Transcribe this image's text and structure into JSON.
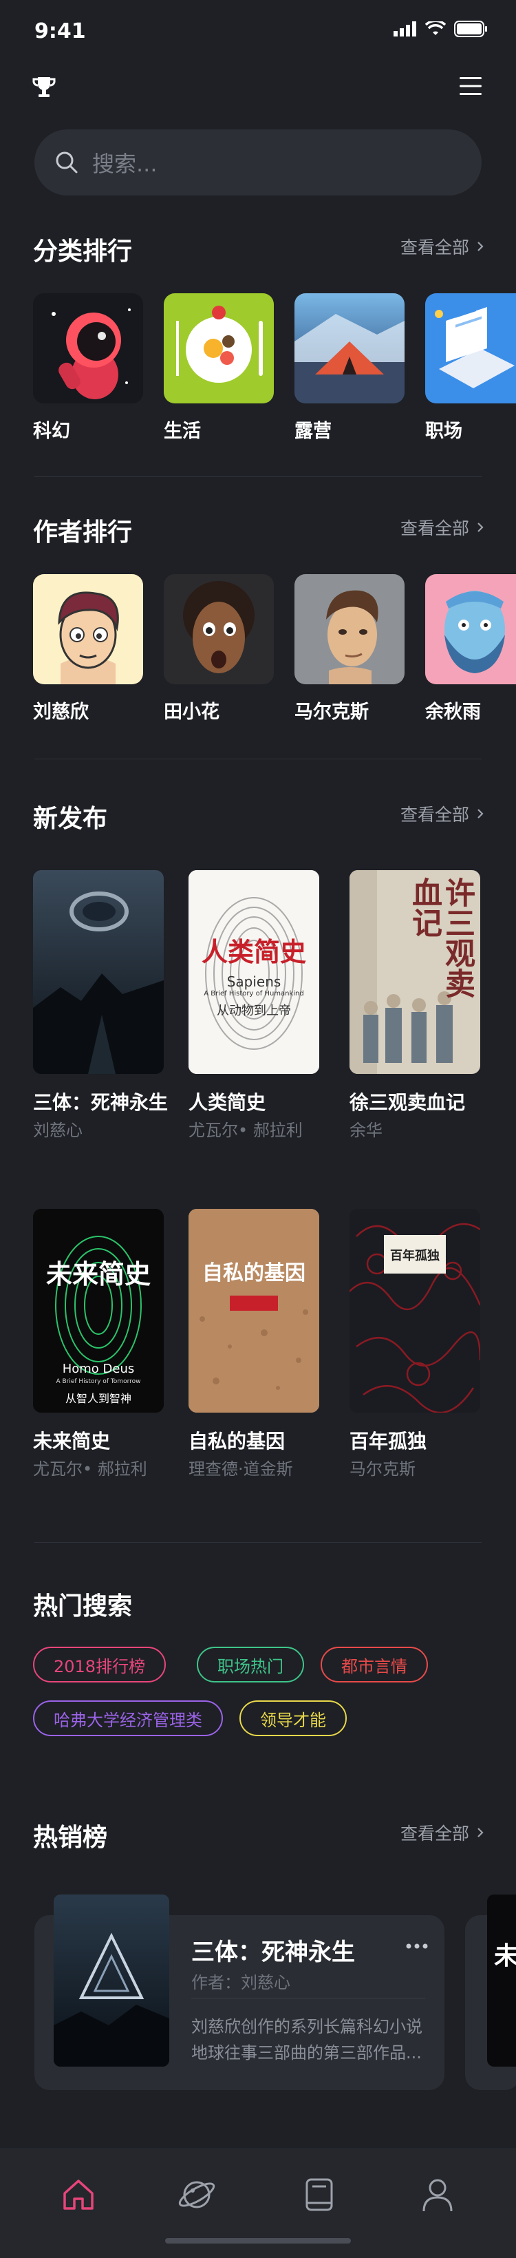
{
  "status": {
    "time": "9:41"
  },
  "search": {
    "placeholder": "搜索..."
  },
  "categories": {
    "title": "分类排行",
    "view_all": "查看全部",
    "items": [
      {
        "label": "科幻",
        "icon": "astronaut-icon"
      },
      {
        "label": "生活",
        "icon": "breakfast-plate-icon"
      },
      {
        "label": "露营",
        "icon": "tent-icon"
      },
      {
        "label": "职场",
        "icon": "laptop-icon"
      }
    ]
  },
  "authors": {
    "title": "作者排行",
    "view_all": "查看全部",
    "items": [
      {
        "name": "刘慈欣"
      },
      {
        "name": "田小花"
      },
      {
        "name": "马尔克斯"
      },
      {
        "name": "余秋雨"
      }
    ]
  },
  "new_releases": {
    "title": "新发布",
    "view_all": "查看全部",
    "books": [
      {
        "title": "三体：死神永生",
        "author": "刘慈心"
      },
      {
        "title": "人类简史",
        "author": "尤瓦尔• 郝拉利",
        "cover_title": "人类简史",
        "cover_sub1": "Sapiens",
        "cover_sub2": "A Brief History of Humankind",
        "cover_sub3": "从动物到上帝"
      },
      {
        "title": "徐三观卖血记",
        "author": "余华",
        "cover_title": "许三观卖血记"
      },
      {
        "title": "未来简史",
        "author": "尤瓦尔• 郝拉利",
        "cover_title": "未来简史",
        "cover_sub1": "Homo Deus",
        "cover_sub2": "A Brief History of Tomorrow",
        "cover_sub3": "从智人到智神"
      },
      {
        "title": "自私的基因",
        "author": "理查德·道金斯",
        "cover_title": "自私的基因"
      },
      {
        "title": "百年孤独",
        "author": "马尔克斯",
        "cover_title": "百年孤独"
      }
    ]
  },
  "hot_search": {
    "title": "热门搜索",
    "tags": [
      {
        "label": "2018排行榜",
        "color": "#e8457a"
      },
      {
        "label": "职场热门",
        "color": "#3fc48a"
      },
      {
        "label": "都市言情",
        "color": "#e84a4a"
      },
      {
        "label": "哈弗大学经济管理类",
        "color": "#9b63e8"
      },
      {
        "label": "领导才能",
        "color": "#e8d84a"
      }
    ]
  },
  "bestsellers": {
    "title": "热销榜",
    "view_all": "查看全部",
    "card": {
      "title": "三体：死神永生",
      "author_label": "作者：刘慈心",
      "desc_line1": "刘慈欣创作的系列长篇科幻小说",
      "desc_line2": "地球往事三部曲的第三部作品..."
    }
  },
  "tabbar": {
    "items": [
      {
        "icon": "home-icon",
        "active": true
      },
      {
        "icon": "planet-icon",
        "active": false
      },
      {
        "icon": "book-icon",
        "active": false
      },
      {
        "icon": "user-icon",
        "active": false
      }
    ]
  },
  "colors": {
    "accent": "#e8457a",
    "background": "#1e2025"
  }
}
